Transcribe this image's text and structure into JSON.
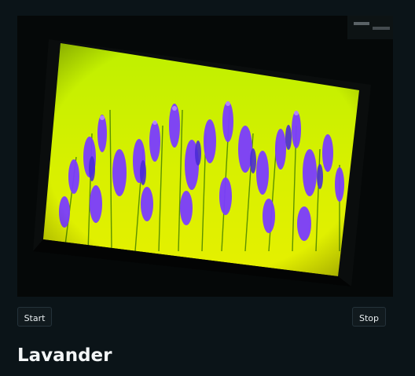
{
  "preview": {
    "content": "camera-feed",
    "subject": "lavender-flowers-photo-on-monitor",
    "colors": {
      "background": "#0b1418",
      "frame": "#050808",
      "lime": "#b8f000",
      "yellow": "#e8f000",
      "purple": "#7b3cff",
      "violet": "#4a2bd6"
    }
  },
  "controls": {
    "start_label": "Start",
    "stop_label": "Stop"
  },
  "page": {
    "title": "Lavander"
  }
}
